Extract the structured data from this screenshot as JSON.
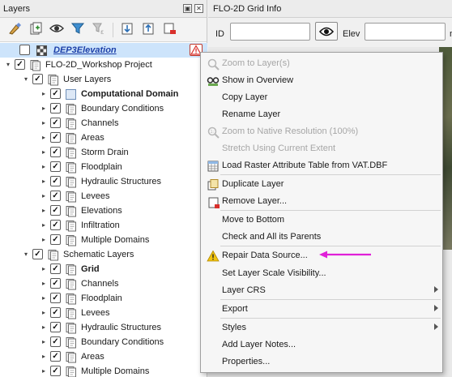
{
  "layers_panel": {
    "title": "Layers",
    "toolbar_icons": [
      "open-layer-styling-icon",
      "add-group-icon",
      "manage-visibility-icon",
      "filter-legend-icon",
      "filter-by-expression-icon",
      "expand-all-icon",
      "collapse-all-icon",
      "remove-layer-icon"
    ],
    "rows": [
      {
        "label": "DEP3Elevation",
        "style": "elevation",
        "checked": false,
        "warning": true,
        "selected": true
      },
      {
        "label": "FLO-2D_Workshop Project",
        "style": "normal",
        "checked": true,
        "expanded": true
      },
      {
        "label": "User Layers",
        "style": "normal",
        "checked": true,
        "expanded": true
      },
      {
        "label": "Computational Domain",
        "style": "bold",
        "checked": true
      },
      {
        "label": "Boundary Conditions",
        "style": "normal",
        "checked": true
      },
      {
        "label": "Channels",
        "style": "normal",
        "checked": true
      },
      {
        "label": "Areas",
        "style": "normal",
        "checked": true
      },
      {
        "label": "Storm Drain",
        "style": "normal",
        "checked": true
      },
      {
        "label": "Floodplain",
        "style": "normal",
        "checked": true
      },
      {
        "label": "Hydraulic Structures",
        "style": "normal",
        "checked": true
      },
      {
        "label": "Levees",
        "style": "normal",
        "checked": true
      },
      {
        "label": "Elevations",
        "style": "normal",
        "checked": true
      },
      {
        "label": "Infiltration",
        "style": "normal",
        "checked": true
      },
      {
        "label": "Multiple Domains",
        "style": "normal",
        "checked": true
      },
      {
        "label": "Schematic Layers",
        "style": "normal",
        "checked": true,
        "expanded": true
      },
      {
        "label": "Grid",
        "style": "bold",
        "checked": true
      },
      {
        "label": "Channels",
        "style": "normal",
        "checked": true
      },
      {
        "label": "Floodplain",
        "style": "normal",
        "checked": true
      },
      {
        "label": "Levees",
        "style": "normal",
        "checked": true
      },
      {
        "label": "Hydraulic Structures",
        "style": "normal",
        "checked": true
      },
      {
        "label": "Boundary Conditions",
        "style": "normal",
        "checked": true
      },
      {
        "label": "Areas",
        "style": "normal",
        "checked": true
      },
      {
        "label": "Multiple Domains",
        "style": "normal",
        "checked": true
      }
    ]
  },
  "grid_info": {
    "title": "FLO-2D Grid Info",
    "id_label": "ID",
    "id_value": "",
    "elev_label": "Elev",
    "elev_value": "",
    "next_label": "n"
  },
  "context_menu": {
    "items": [
      {
        "label": "Zoom to Layer(s)",
        "icon": "zoom-to-layer-icon",
        "disabled": true
      },
      {
        "label": "Show in Overview",
        "icon": "show-overview-icon",
        "disabled": false
      },
      {
        "label": "Copy Layer",
        "icon": "",
        "disabled": false
      },
      {
        "label": "Rename Layer",
        "icon": "",
        "disabled": false
      },
      {
        "label": "Zoom to Native Resolution (100%)",
        "icon": "zoom-native-icon",
        "disabled": true
      },
      {
        "label": "Stretch Using Current Extent",
        "icon": "",
        "disabled": true
      },
      {
        "label": "Load Raster Attribute Table from VAT.DBF",
        "icon": "attribute-table-icon",
        "disabled": false
      },
      {
        "label": "Duplicate Layer",
        "icon": "duplicate-layer-icon",
        "disabled": false
      },
      {
        "label": "Remove Layer...",
        "icon": "remove-layer-icon",
        "disabled": false
      },
      {
        "label": "Move to Bottom",
        "icon": "",
        "disabled": false
      },
      {
        "label": "Check and All its Parents",
        "icon": "",
        "disabled": false
      },
      {
        "label": "Repair Data Source...",
        "icon": "warning-icon",
        "disabled": false
      },
      {
        "label": "Set Layer Scale Visibility...",
        "icon": "",
        "disabled": false
      },
      {
        "label": "Layer CRS",
        "icon": "",
        "disabled": false,
        "submenu": true
      },
      {
        "label": "Export",
        "icon": "",
        "disabled": false,
        "submenu": true
      },
      {
        "label": "Styles",
        "icon": "",
        "disabled": false,
        "submenu": true
      },
      {
        "label": "Add Layer Notes...",
        "icon": "",
        "disabled": false
      },
      {
        "label": "Properties...",
        "icon": "",
        "disabled": false
      }
    ]
  },
  "colors": {
    "selection": "#cde4fb",
    "pointer_arrow": "#e020d8",
    "warning": "#f1c40f",
    "elevation_text": "#1c3fa8"
  }
}
